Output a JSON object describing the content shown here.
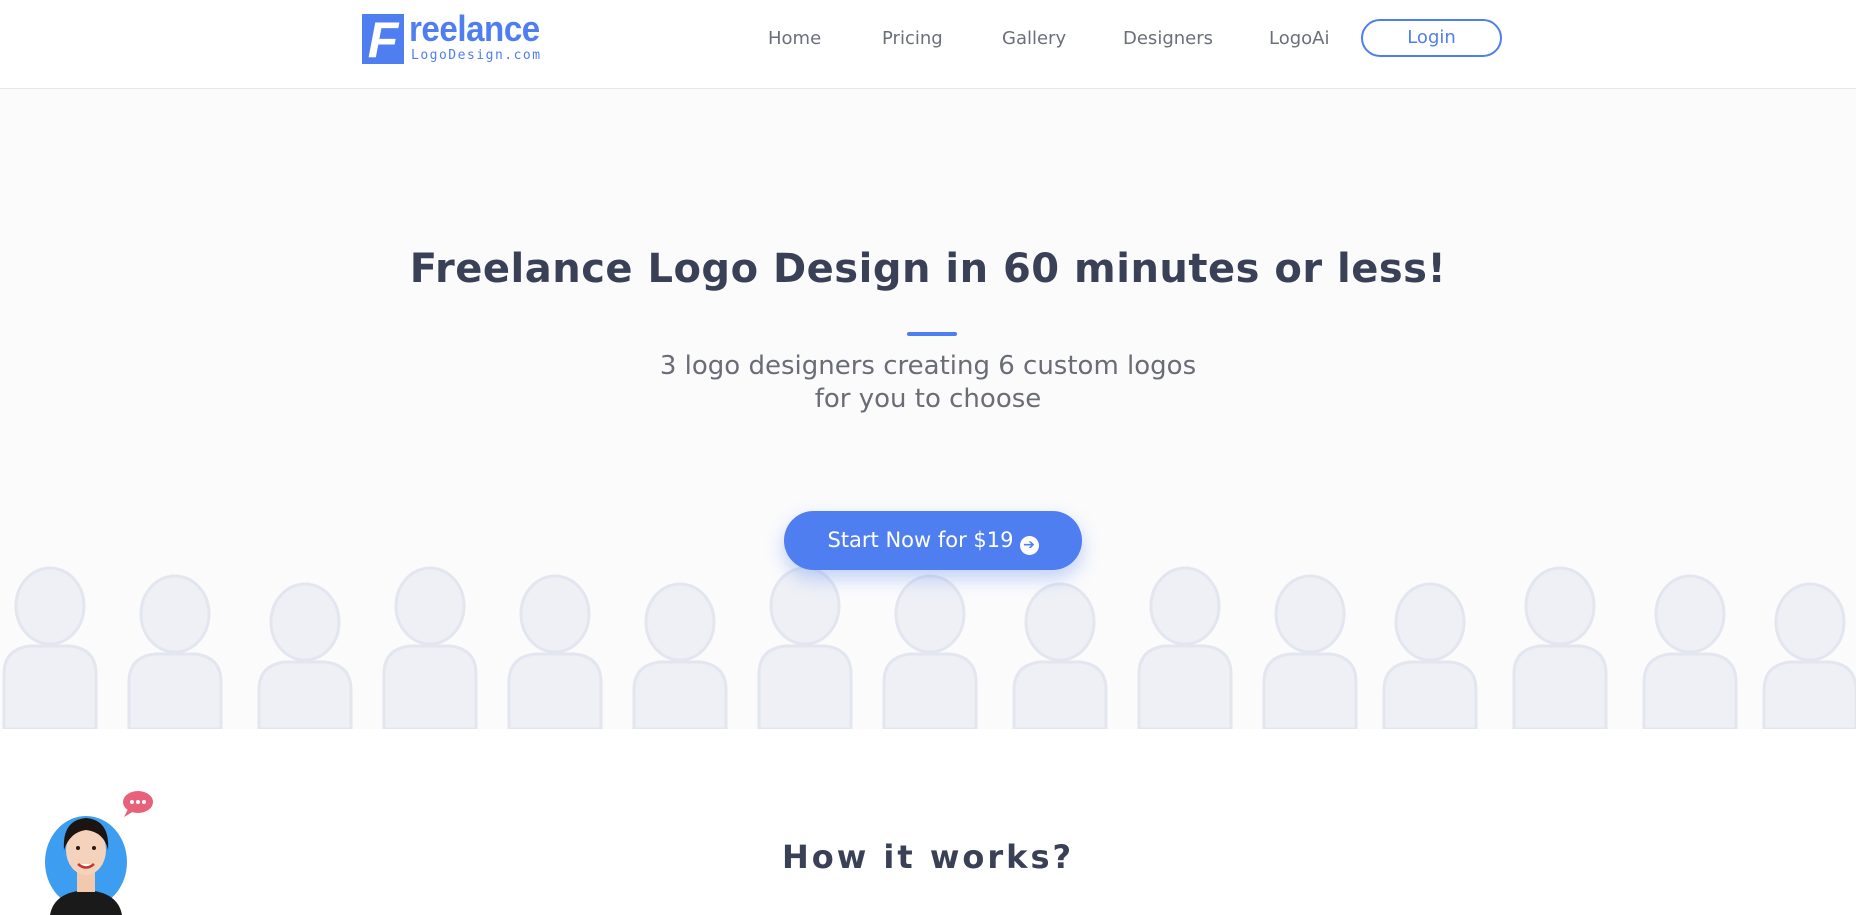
{
  "brand": {
    "logo_letter": "F",
    "logo_word": "reelance",
    "logo_sub": "LogoDesign.com",
    "accent_color": "#4f7ef0"
  },
  "nav": {
    "items": [
      {
        "label": "Home"
      },
      {
        "label": "Pricing"
      },
      {
        "label": "Gallery"
      },
      {
        "label": "Designers"
      },
      {
        "label": "LogoAi"
      }
    ],
    "login_label": "Login"
  },
  "hero": {
    "title": "Freelance Logo Design in 60 minutes or less!",
    "subtitle_line1": "3 logo designers creating 6 custom logos",
    "subtitle_line2": "for you to choose",
    "cta_label": "Start Now for $19",
    "cta_icon": "arrow-circle-right-icon"
  },
  "how": {
    "title": "How it works?"
  },
  "chat": {
    "bubble_icon": "chat-bubble-icon",
    "bubble_color": "#e8607a",
    "avatar_bg": "#3d9df0"
  }
}
